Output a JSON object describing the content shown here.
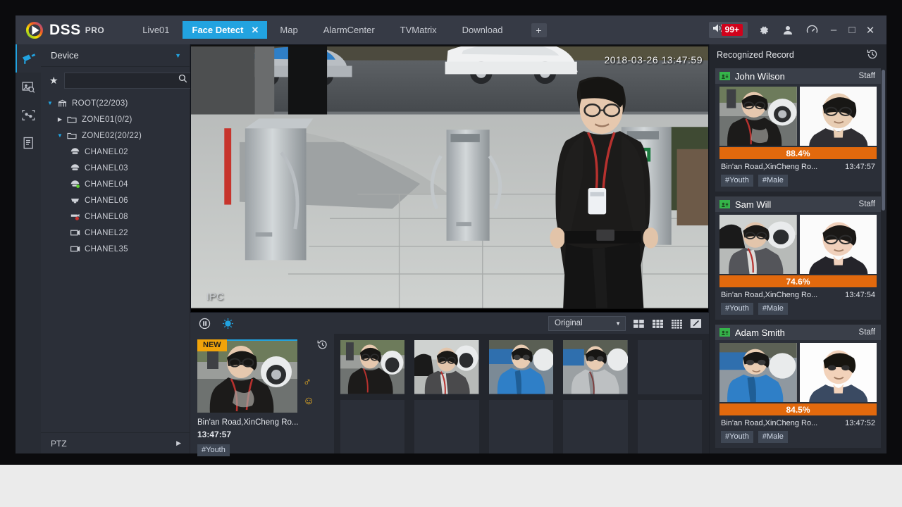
{
  "app": {
    "brand": "DSS",
    "brand_suffix": "PRO",
    "tabs": [
      {
        "label": "Live01",
        "active": false,
        "closable": false
      },
      {
        "label": "Face Detect",
        "active": true,
        "closable": true
      },
      {
        "label": "Map",
        "active": false,
        "closable": false
      },
      {
        "label": "AlarmCenter",
        "active": false,
        "closable": false
      },
      {
        "label": "TVMatrix",
        "active": false,
        "closable": false
      },
      {
        "label": "Download",
        "active": false,
        "closable": false
      }
    ],
    "add_tab_label": "+",
    "alarm_badge": "99+",
    "window_buttons": {
      "minimize": "–",
      "maximize": "□",
      "close": "✕"
    },
    "accent_color": "#22a3e0",
    "alarm_color": "#d0021b"
  },
  "rail": {
    "items": [
      {
        "name": "live-view",
        "active": true
      },
      {
        "name": "face-search",
        "active": false
      },
      {
        "name": "face-compare",
        "active": false
      },
      {
        "name": "report",
        "active": false
      }
    ]
  },
  "device": {
    "title": "Device",
    "search_value": "",
    "search_placeholder": "",
    "tree": [
      {
        "label": "ROOT(22/203)",
        "depth": 0,
        "icon": "root-icon",
        "expanded": true
      },
      {
        "label": "ZONE01(0/2)",
        "depth": 1,
        "icon": "folder-icon",
        "expanded": false
      },
      {
        "label": "ZONE02(20/22)",
        "depth": 1,
        "icon": "folder-icon",
        "expanded": true
      },
      {
        "label": "CHANEL02",
        "depth": 2,
        "icon": "dome-camera-icon",
        "status": "offline"
      },
      {
        "label": "CHANEL03",
        "depth": 2,
        "icon": "dome-camera-icon",
        "status": "offline"
      },
      {
        "label": "CHANEL04",
        "depth": 2,
        "icon": "dome-camera-icon",
        "status": "online"
      },
      {
        "label": "CHANEL06",
        "depth": 2,
        "icon": "dome-camera-icon",
        "status": "offline"
      },
      {
        "label": "CHANEL08",
        "depth": 2,
        "icon": "box-camera-icon",
        "status": "alarm"
      },
      {
        "label": "CHANEL22",
        "depth": 2,
        "icon": "ipc-camera-icon",
        "status": "offline"
      },
      {
        "label": "CHANEL35",
        "depth": 2,
        "icon": "ipc-camera-icon",
        "status": "offline"
      }
    ],
    "ptz_label": "PTZ"
  },
  "video": {
    "timestamp": "2018-03-26 13:47:59",
    "channel_label": "IPC",
    "toolbar": {
      "stream_select": "Original",
      "layouts": [
        "layout-4",
        "layout-9",
        "layout-16",
        "layout-edit"
      ]
    }
  },
  "new_card": {
    "badge": "NEW",
    "address": "Bin'an Road,XinCheng Ro...",
    "time": "13:47:57",
    "gender_icon": "♂",
    "expression_icon": "☺",
    "tags": [
      "#Youth"
    ]
  },
  "thumbnails": {
    "count": 10,
    "filled": 4
  },
  "recognized": {
    "title": "Recognized Record",
    "records": [
      {
        "name": "John Wilson",
        "role": "Staff",
        "similarity": "88.4%",
        "address": "Bin'an Road,XinCheng Ro...",
        "time": "13:47:57",
        "tags": [
          "#Youth",
          "#Male"
        ]
      },
      {
        "name": "Sam Will",
        "role": "Staff",
        "similarity": "74.6%",
        "address": "Bin'an Road,XinCheng Ro...",
        "time": "13:47:54",
        "tags": [
          "#Youth",
          "#Male"
        ]
      },
      {
        "name": "Adam Smith",
        "role": "Staff",
        "similarity": "84.5%",
        "address": "Bin'an Road,XinCheng Ro...",
        "time": "13:47:52",
        "tags": [
          "#Youth",
          "#Male"
        ]
      }
    ]
  }
}
